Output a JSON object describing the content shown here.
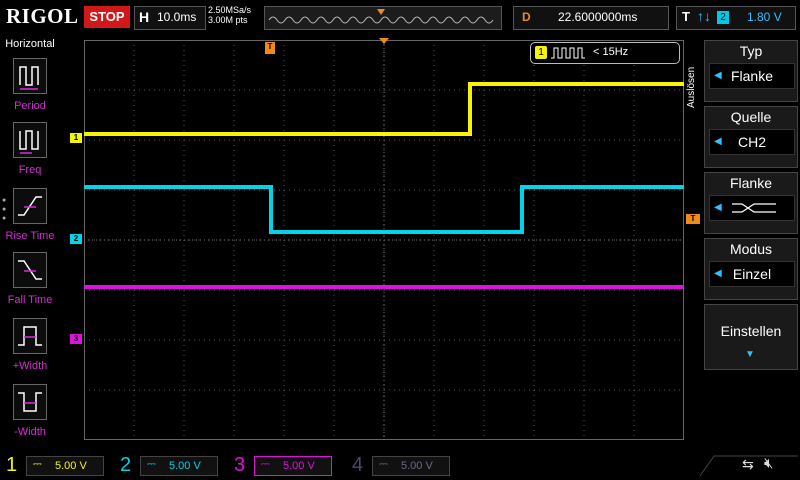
{
  "brand": "RIGOL",
  "run_state": "STOP",
  "horizontal": {
    "key": "H",
    "timebase": "10.0ms"
  },
  "sample": {
    "rate": "2.50MSa/s",
    "points": "3.00M pts"
  },
  "delay": {
    "key": "D",
    "value": "22.6000000ms"
  },
  "trigger": {
    "key": "T",
    "edge_icon": "edge-both-icon",
    "source": "2",
    "level": "1.80 V"
  },
  "frequency_counter": {
    "channel": "1",
    "value": "< 15Hz"
  },
  "left_menu": {
    "title": "Horizontal",
    "items": [
      {
        "label": "Period",
        "icon": "period-icon"
      },
      {
        "label": "Freq",
        "icon": "freq-icon"
      },
      {
        "label": "Rise Time",
        "icon": "rise-time-icon"
      },
      {
        "label": "Fall Time",
        "icon": "fall-time-icon"
      },
      {
        "label": "+Width",
        "icon": "pos-width-icon"
      },
      {
        "label": "-Width",
        "icon": "neg-width-icon"
      }
    ]
  },
  "right_menu": {
    "vertical_label": "Auslösen",
    "items": [
      {
        "title": "Typ",
        "value": "Flanke"
      },
      {
        "title": "Quelle",
        "value": "CH2"
      },
      {
        "title": "Flanke",
        "value": ""
      },
      {
        "title": "Modus",
        "value": "Einzel"
      },
      {
        "title": "Einstellen",
        "value": ""
      }
    ]
  },
  "channels": [
    {
      "num": "1",
      "scale": "5.00 V",
      "color": "#f5f500",
      "active": true
    },
    {
      "num": "2",
      "scale": "5.00 V",
      "color": "#00d4e8",
      "active": true
    },
    {
      "num": "3",
      "scale": "5.00 V",
      "color": "#e010e0",
      "active": true
    },
    {
      "num": "4",
      "scale": "5.00 V",
      "color": "#3a5acc",
      "active": false
    }
  ],
  "colors": {
    "ch1": "#f5f500",
    "ch2": "#00d4e8",
    "ch3": "#e010e0",
    "trigger_marker": "#f08a1a",
    "menu_accent": "#d62cd6",
    "stop_red": "#d01818"
  }
}
